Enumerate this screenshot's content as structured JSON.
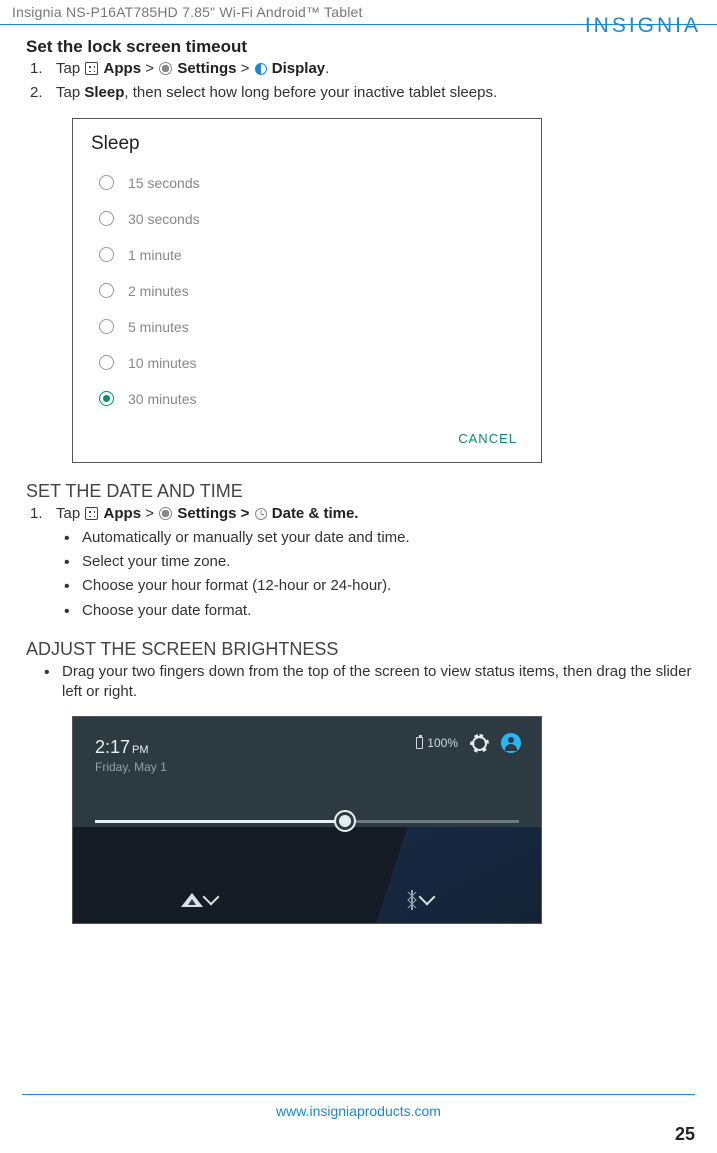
{
  "header": {
    "product_line": "Insignia  NS-P16AT785HD  7.85\" Wi-Fi Android™ Tablet",
    "brand": "INSIGNIA"
  },
  "section_lock": {
    "title": "Set the lock screen timeout",
    "step1_pre": "Tap ",
    "step1_apps": "Apps",
    "step1_gt1": " > ",
    "step1_settings": "Settings",
    "step1_gt2": " > ",
    "step1_display": "Display",
    "step1_end": ".",
    "step2_pre": "Tap ",
    "step2_sleep": "Sleep",
    "step2_rest": ", then select how long before your inactive tablet sleeps."
  },
  "sleep_dialog": {
    "title": "Sleep",
    "options": [
      "15 seconds",
      "30 seconds",
      "1 minute",
      "2 minutes",
      "5 minutes",
      "10 minutes",
      "30 minutes"
    ],
    "selected_index": 6,
    "cancel": "CANCEL"
  },
  "section_date": {
    "title": "SET THE DATE AND TIME",
    "step1_pre": "Tap ",
    "step1_apps": "Apps",
    "step1_gt1": " > ",
    "step1_settings": "Settings > ",
    "step1_datetime": "Date & time.",
    "bullets": [
      "Automatically or manually set your date and time.",
      "Select your time zone.",
      "Choose your hour format (12-hour or 24-hour).",
      "Choose your date format."
    ]
  },
  "section_bright": {
    "title": "ADJUST THE SCREEN BRIGHTNESS",
    "bullet": "Drag your two fingers down from the top of the screen to view status items, then drag the slider left or right."
  },
  "bright_shot": {
    "battery": "100%",
    "time": "2:17",
    "ampm": "PM",
    "date": "Friday, May 1"
  },
  "footer": {
    "url": "www.insigniaproducts.com",
    "page": "25"
  }
}
